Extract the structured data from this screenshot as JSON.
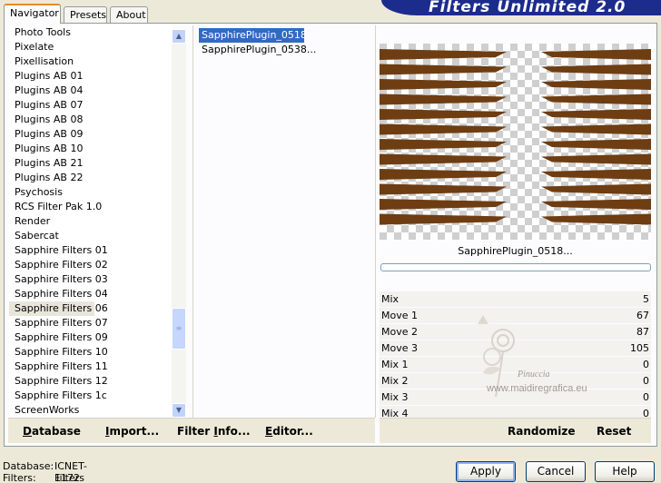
{
  "window": {
    "title": "Filters Unlimited 2.0"
  },
  "tabs": [
    {
      "label": "Navigator",
      "active": true
    },
    {
      "label": "Presets",
      "active": false
    },
    {
      "label": "About",
      "active": false
    }
  ],
  "categories": [
    "Photo Tools",
    "Pixelate",
    "Pixellisation",
    "Plugins AB 01",
    "Plugins AB 04",
    "Plugins AB 07",
    "Plugins AB 08",
    "Plugins AB 09",
    "Plugins AB 10",
    "Plugins AB 21",
    "Plugins AB 22",
    "Psychosis",
    "RCS Filter Pak 1.0",
    "Render",
    "Sabercat",
    "Sapphire Filters 01",
    "Sapphire Filters 02",
    "Sapphire Filters 03",
    "Sapphire Filters 04",
    "Sapphire Filters 06",
    "Sapphire Filters 07",
    "Sapphire Filters 09",
    "Sapphire Filters 10",
    "Sapphire Filters 11",
    "Sapphire Filters 12",
    "Sapphire Filters 1c",
    "ScreenWorks"
  ],
  "selected_category": "Sapphire Filters 06",
  "filters": [
    "SapphirePlugin_0518...",
    "SapphirePlugin_0538..."
  ],
  "selected_filter": "SapphirePlugin_0518...",
  "preview": {
    "filter_name": "SapphirePlugin_0518...",
    "stripe_color": "#6e3d12"
  },
  "params": [
    {
      "name": "Mix",
      "value": "5"
    },
    {
      "name": "Move 1",
      "value": "67"
    },
    {
      "name": "Move 2",
      "value": "87"
    },
    {
      "name": "Move 3",
      "value": "105"
    },
    {
      "name": "Mix 1",
      "value": "0"
    },
    {
      "name": "Mix 2",
      "value": "0"
    },
    {
      "name": "Mix 3",
      "value": "0"
    },
    {
      "name": "Mix 4",
      "value": "0"
    }
  ],
  "watermark": {
    "name": "Pinuccia",
    "site": "www.maidiregrafica.eu"
  },
  "toolbar": {
    "database": {
      "label": "Database",
      "underline": "D"
    },
    "import": {
      "label": "Import...",
      "underline": "I"
    },
    "filter_info": {
      "label": "Filter Info...",
      "underline": "F"
    },
    "editor": {
      "label": "Editor...",
      "underline": "E"
    },
    "randomize": "Randomize",
    "reset": "Reset"
  },
  "status": {
    "database_label": "Database:",
    "database_value": "ICNET-Filters",
    "filters_label": "Filters:",
    "filters_value": "1172"
  },
  "buttons": {
    "apply": "Apply",
    "cancel": "Cancel",
    "help": "Help"
  },
  "colors": {
    "selection": "#316ac5",
    "banner": "#1c2c8c",
    "tab_accent": "#e68b2c"
  }
}
